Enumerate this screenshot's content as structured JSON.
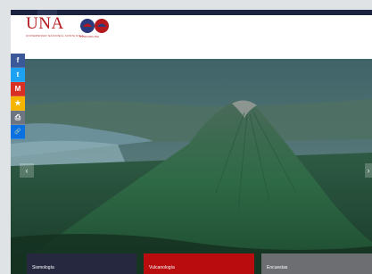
{
  "header": {
    "una_logo_text": "UNA",
    "una_logo_subtitle": "UNIVERSIDAD NACIONAL COSTA RICA",
    "partner_logo_caption": "OVSICORI-UNA"
  },
  "share_buttons": [
    {
      "name": "facebook",
      "icon": "f",
      "color": "#3b5998"
    },
    {
      "name": "twitter",
      "icon": "t",
      "color": "#1da1f2"
    },
    {
      "name": "gmail",
      "icon": "M",
      "color": "#d93025"
    },
    {
      "name": "favorites",
      "icon": "★",
      "color": "#f5b400"
    },
    {
      "name": "print",
      "icon": "⎙",
      "color": "#6d7680"
    },
    {
      "name": "copy-link",
      "icon": "🔗",
      "color": "#0c71e0"
    }
  ],
  "carousel": {
    "prev_icon": "‹",
    "next_icon": "›"
  },
  "cards": [
    {
      "label": "Sismología",
      "color": "#262840"
    },
    {
      "label": "Vulcanología",
      "color": "#b80c0f"
    },
    {
      "label": "Encuestas",
      "color": "#6c6e72"
    }
  ]
}
